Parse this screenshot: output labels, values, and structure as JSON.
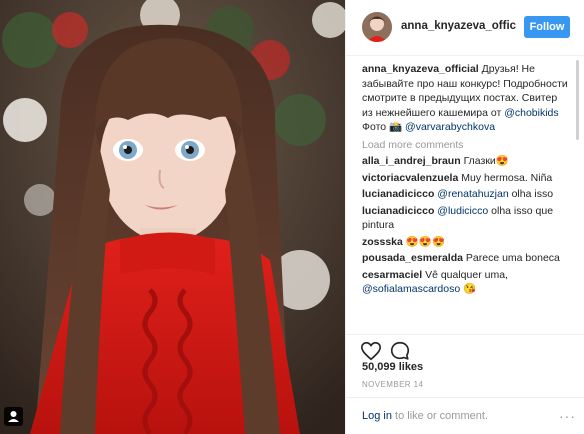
{
  "post": {
    "username": "anna_knyazeva_official",
    "follow_label": "Follow",
    "caption_parts": {
      "text1": "Друзья! Не забывайте про наш конкурс! Подробности смотрите в предыдущих постах. Свитер из нежнейшего кашемира от ",
      "mention1": "@chobikids",
      "text2": "Фото 📸 ",
      "mention2": "@varvarabychkova"
    },
    "load_more": "Load more comments",
    "comments": [
      {
        "user": "alla_i_andrej_braun",
        "text": "Глазки😍",
        "mention": ""
      },
      {
        "user": "victoriacvalenzuela",
        "text": "Muy hermosa. Niña",
        "mention": ""
      },
      {
        "user": "lucianadicicco",
        "mention": "@renatahuzjan",
        "text": " olha isso"
      },
      {
        "user": "lucianadicicco",
        "mention": "@ludicicco",
        "text": " olha isso que pintura"
      },
      {
        "user": "zossska",
        "text": "😍😍😍",
        "mention": ""
      },
      {
        "user": "pousada_esmeralda",
        "text": "Parece uma boneca",
        "mention": ""
      },
      {
        "user": "cesarmaciel",
        "text": "Vê qualquer uma, ",
        "mention": "@sofialamascardoso",
        "tail": " 😘"
      }
    ],
    "likes": "50,099 likes",
    "date": "NOVEMBER 14",
    "login_link": "Log in",
    "login_text": " to like or comment.",
    "more_options": "···"
  },
  "icons": {
    "like": "heart-outline-icon",
    "comment": "speech-bubble-icon",
    "user_tag": "user-tag-icon"
  },
  "colors": {
    "follow_bg": "#3897f0",
    "mention": "#003569",
    "muted": "#999999",
    "text": "#262626"
  }
}
